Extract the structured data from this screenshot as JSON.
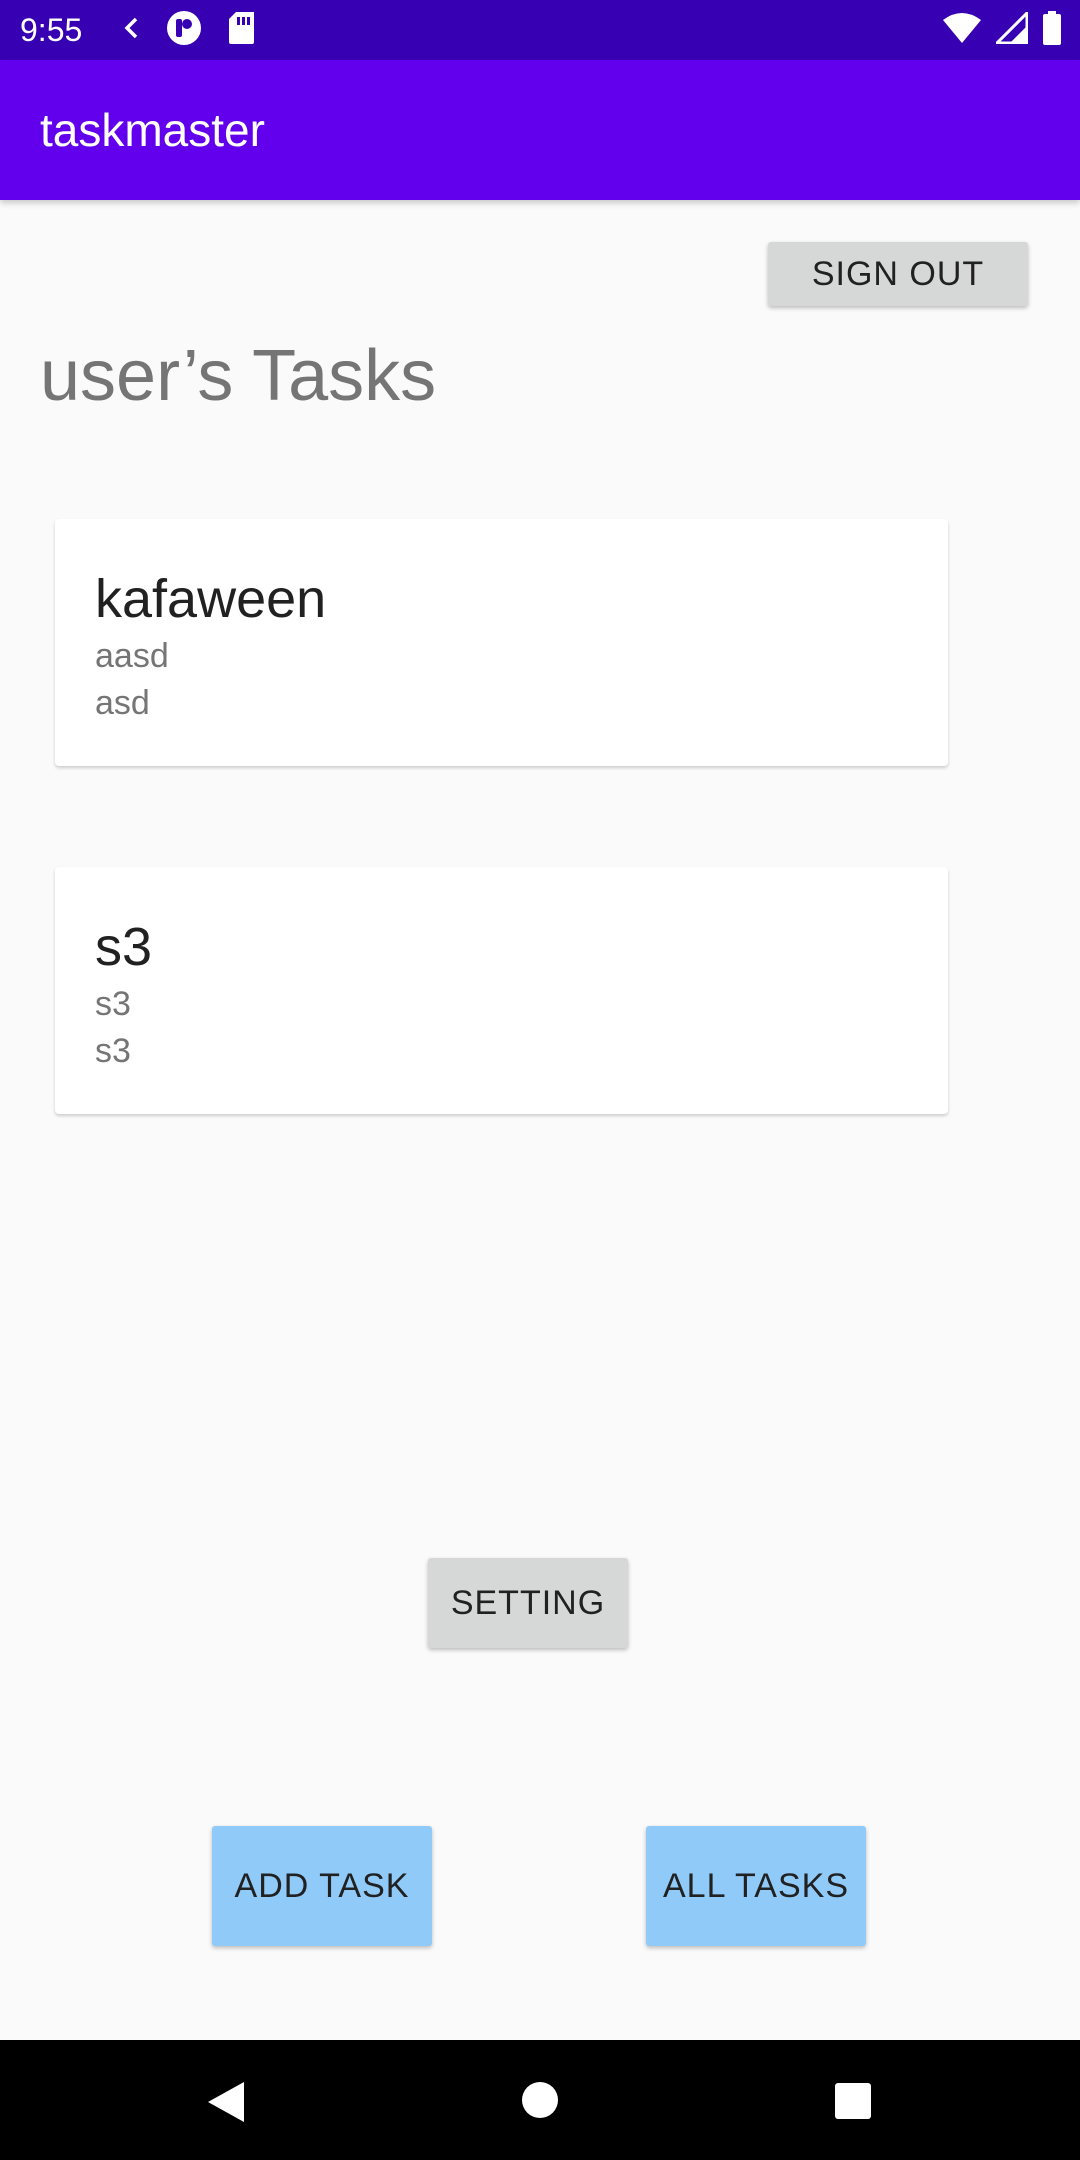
{
  "status_bar": {
    "time": "9:55",
    "background_color": "#3700b3",
    "left_icons": [
      "chevron-left-icon",
      "app-notification-icon",
      "sd-card-icon"
    ],
    "right_icons": [
      "wifi-icon",
      "cell-signal-icon",
      "battery-icon"
    ]
  },
  "app_bar": {
    "title": "taskmaster",
    "background_color": "#6200ee"
  },
  "header": {
    "sign_out_label": "SIGN OUT",
    "heading": "user’s Tasks"
  },
  "tasks": [
    {
      "title": "kafaween",
      "body": "aasd",
      "state": "asd"
    },
    {
      "title": "s3",
      "body": "s3",
      "state": "s3"
    }
  ],
  "actions": {
    "setting_label": "SETTING",
    "add_task_label": "ADD TASK",
    "all_tasks_label": "ALL TASKS",
    "primary_button_color": "#90caf9",
    "secondary_button_color": "#d6d7d7"
  },
  "nav_bar": {
    "icons": [
      "back-icon",
      "home-icon",
      "recents-icon"
    ]
  }
}
